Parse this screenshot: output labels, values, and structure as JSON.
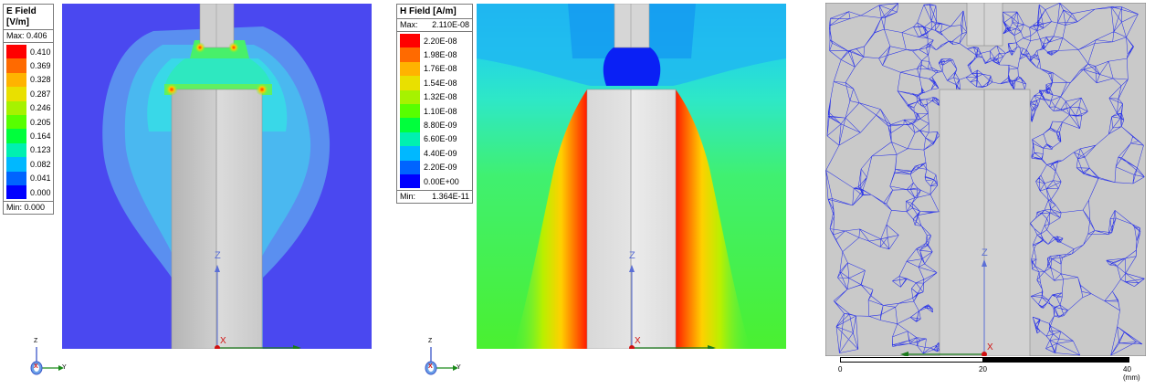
{
  "efield": {
    "title_line1": "E Field",
    "title_line2": "[V/m]",
    "max_label": "Max: 0.406",
    "min_label": "Min: 0.000",
    "levels": [
      "0.410",
      "0.369",
      "0.328",
      "0.287",
      "0.246",
      "0.205",
      "0.164",
      "0.123",
      "0.082",
      "0.041",
      "0.000"
    ],
    "colors": [
      "#ff0000",
      "#ff6a00",
      "#ffb300",
      "#e9e000",
      "#a6f200",
      "#57ff00",
      "#00ff3c",
      "#00f0b0",
      "#00b8ff",
      "#0064ff",
      "#0000ff"
    ]
  },
  "hfield": {
    "title": "H Field [A/m]",
    "max_label": "Max:",
    "max_value": "2.110E-08",
    "min_label": "Min:",
    "min_value": "1.364E-11",
    "levels": [
      "2.20E-08",
      "1.98E-08",
      "1.76E-08",
      "1.54E-08",
      "1.32E-08",
      "1.10E-08",
      "8.80E-09",
      "6.60E-09",
      "4.40E-09",
      "2.20E-09",
      "0.00E+00"
    ],
    "colors": [
      "#ff0000",
      "#ff6a00",
      "#ffb300",
      "#e9e000",
      "#a6f200",
      "#57ff00",
      "#00ff3c",
      "#00f0b0",
      "#00b8ff",
      "#0064ff",
      "#0000ff"
    ]
  },
  "axes": {
    "z": "Z",
    "x": "X",
    "y": "Y"
  },
  "scalebar": {
    "tick0": "0",
    "tick20": "20",
    "tick40": "40 (mm)"
  },
  "icons": {
    "triad": "axis-triad-icon"
  }
}
